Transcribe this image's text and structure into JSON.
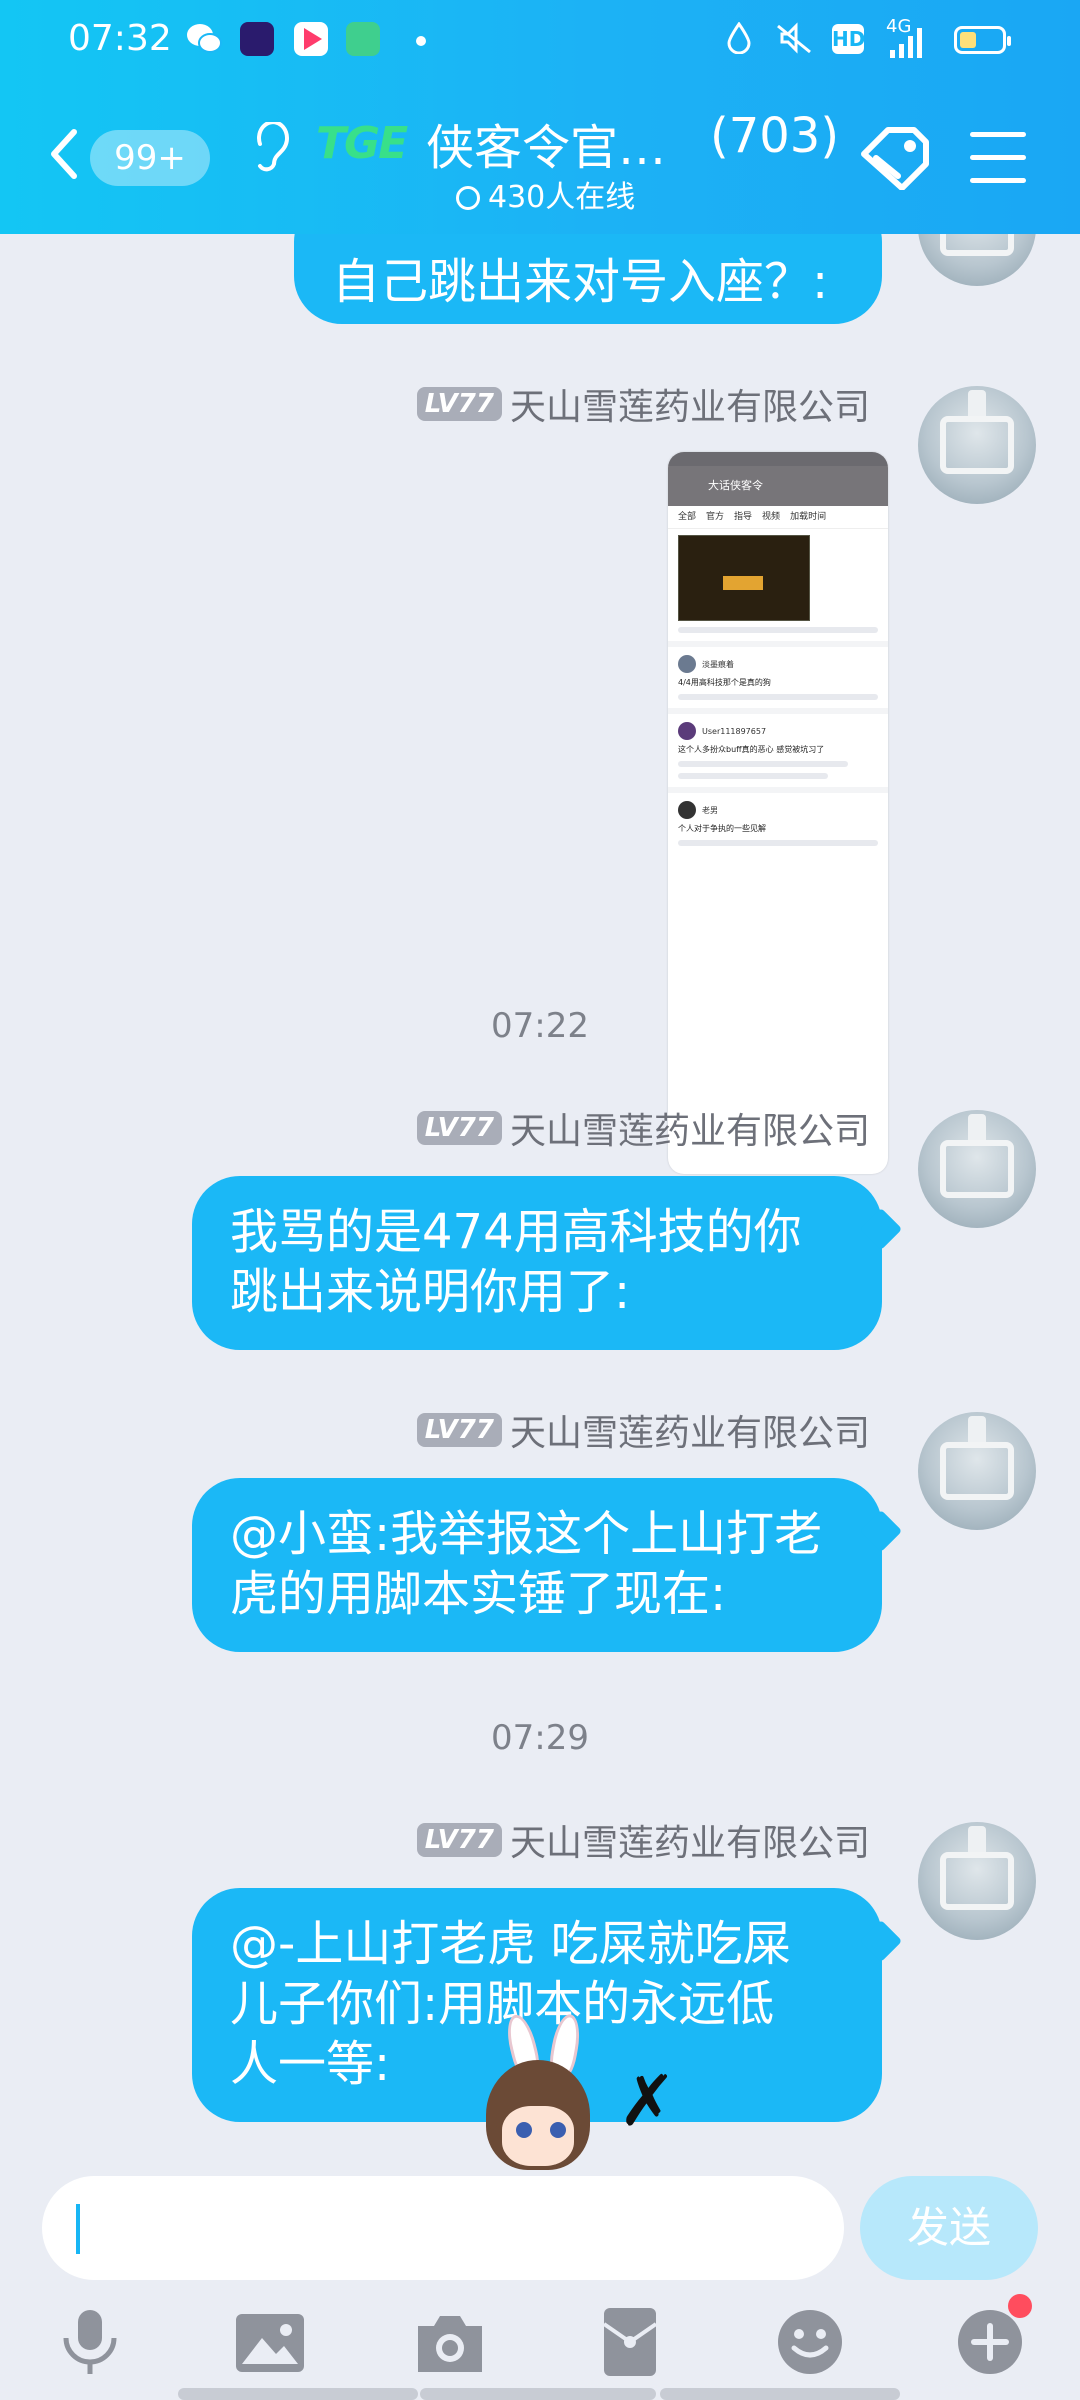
{
  "status_bar": {
    "time": "07:32",
    "hd_label": "HD",
    "network": "4G",
    "app_icons": [
      "wechat-icon",
      "video-app-icon",
      "youku-icon",
      "green-app-icon"
    ],
    "right_icons": [
      "droplet-icon",
      "mute-vibrate-icon",
      "hd-icon",
      "signal-4g-icon",
      "battery-icon"
    ]
  },
  "header": {
    "unread_count": "99+",
    "group_logo": "TGE",
    "group_title": "侠客令官…",
    "member_count": "(703)",
    "online_text": "430人在线",
    "icons": [
      "back-arrow-icon",
      "ear-icon",
      "tag-icon",
      "menu-icon"
    ]
  },
  "messages": [
    {
      "type": "text",
      "text": "自己跳出来对号入座？:"
    },
    {
      "type": "image",
      "level": "LV77",
      "sender": "天山雪莲药业有限公司",
      "thumb": {
        "header": "大话侠客令",
        "tabs": [
          "全部",
          "官方",
          "指导",
          "视频",
          "加载时间"
        ],
        "users": [
          {
            "name": "淡墨痕着",
            "text": "4/4用高科技那个是真的狗"
          },
          {
            "name": "User111897657",
            "text": "这个人多扮众buff真的恶心 感觉被坑习了"
          },
          {
            "name": "老男",
            "text": "个人对于争执的一些见解"
          }
        ]
      }
    },
    {
      "type": "time",
      "text": "07:22"
    },
    {
      "type": "text",
      "level": "LV77",
      "sender": "天山雪莲药业有限公司",
      "line1": "我骂的是474用高科技的你",
      "line2": "跳出来说明你用了:"
    },
    {
      "type": "text",
      "level": "LV77",
      "sender": "天山雪莲药业有限公司",
      "line1": "@小蛮:我举报这个上山打老",
      "line2": "虎的用脚本实锤了现在:"
    },
    {
      "type": "time",
      "text": "07:29"
    },
    {
      "type": "text",
      "level": "LV77",
      "sender": "天山雪莲药业有限公司",
      "line1": "@-上山打老虎 吃屎就吃屎",
      "line2": "儿子你们:用脚本的永远低",
      "line3": "人一等:"
    }
  ],
  "input": {
    "placeholder": "",
    "send_label": "发送"
  },
  "toolbar": {
    "icons": [
      "microphone-icon",
      "image-icon",
      "camera-icon",
      "red-packet-icon",
      "emoji-icon",
      "plus-icon"
    ],
    "has_notification_dot": true
  },
  "colors": {
    "accent": "#1bb8f6",
    "header_start": "#13c6f4",
    "background": "#eaedf4",
    "level_badge": "#a9adb8"
  }
}
